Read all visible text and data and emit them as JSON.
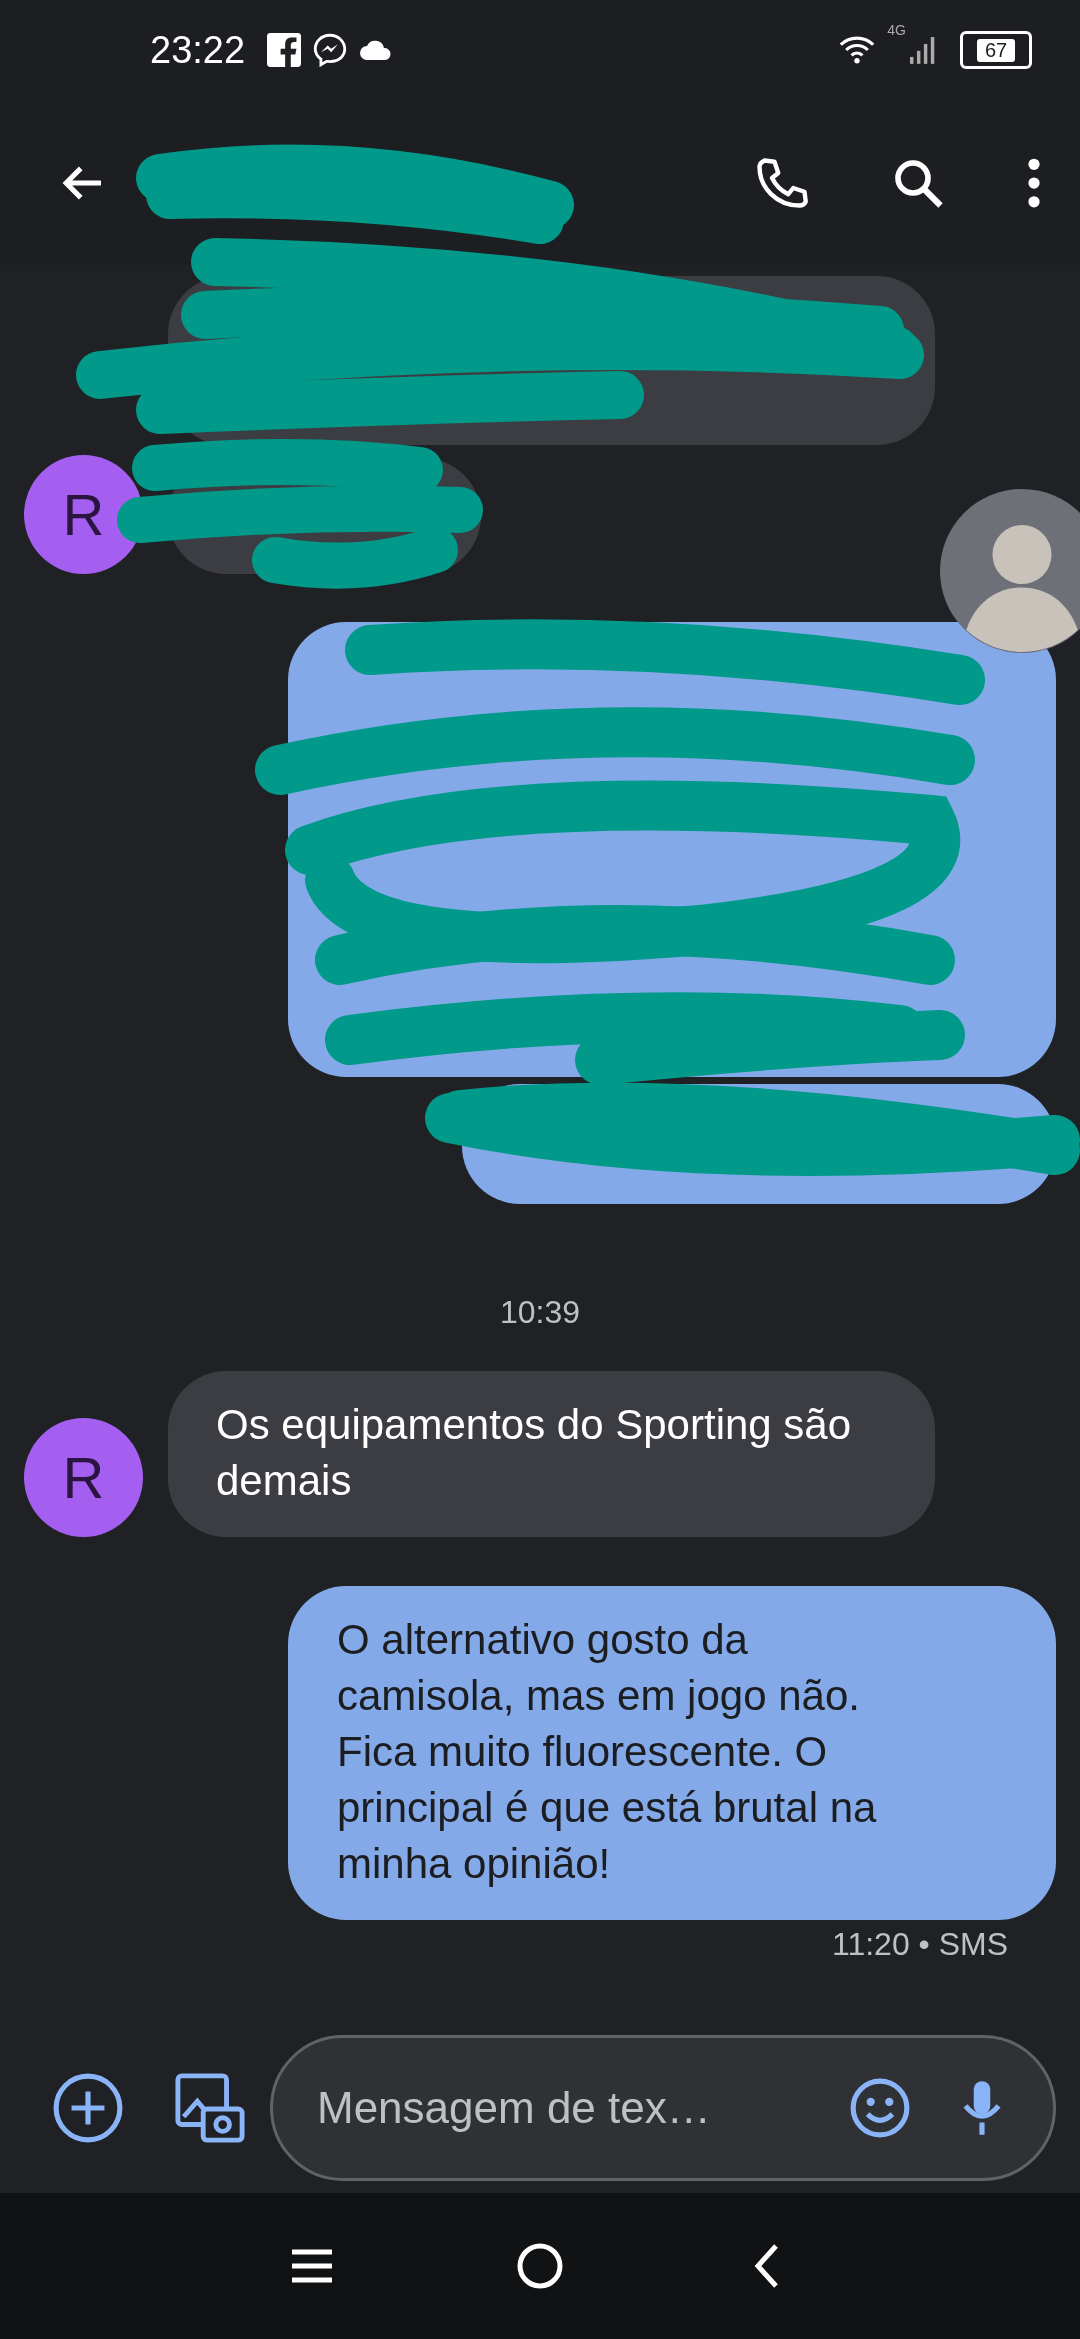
{
  "status_bar": {
    "time": "23:22",
    "network_label": "4G",
    "battery": "67"
  },
  "conversation": [
    {
      "kind": "received",
      "redacted": true
    },
    {
      "kind": "received",
      "redacted": true,
      "avatar": "R"
    },
    {
      "kind": "sent",
      "redacted": true,
      "photo_avatar": true
    },
    {
      "kind": "sent",
      "redacted": true
    },
    {
      "kind": "timestamp",
      "text": "10:39"
    },
    {
      "kind": "received",
      "redacted": false,
      "avatar": "R",
      "text": "Os equipamentos do Sporting são demais"
    },
    {
      "kind": "sent",
      "redacted": false,
      "text": "O alternativo gosto da camisola, mas em jogo não. Fica muito fluorescente. O principal é que está brutal na minha opinião!",
      "status": "11:20 • SMS"
    }
  ],
  "composer": {
    "placeholder": "Mensagem de tex…"
  }
}
